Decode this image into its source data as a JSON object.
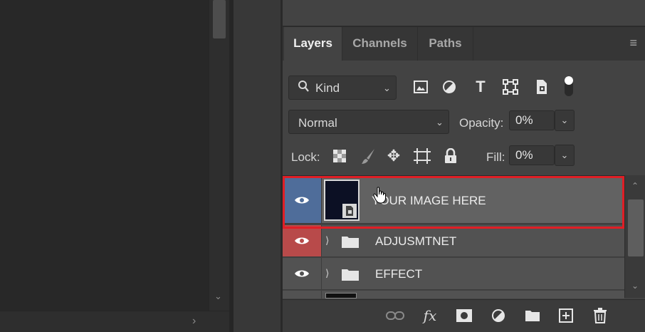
{
  "panel": {
    "tabs": [
      {
        "label": "Layers",
        "active": true
      },
      {
        "label": "Channels",
        "active": false
      },
      {
        "label": "Paths",
        "active": false
      }
    ],
    "menu_icon": "hamburger-icon"
  },
  "filter": {
    "kind_label": "Kind",
    "kind_icon": "search-icon",
    "filter_icons": [
      "image-filter-icon",
      "adjustment-filter-icon",
      "type-filter-icon",
      "shape-filter-icon",
      "smart-object-filter-icon",
      "filter-toggle-icon"
    ]
  },
  "blend": {
    "mode": "Normal",
    "opacity_label": "Opacity:",
    "opacity_value": "0%",
    "fill_label": "Fill:",
    "fill_value": "0%"
  },
  "lock": {
    "label": "Lock:",
    "icons": [
      "lock-transparent-pixels-icon",
      "lock-image-pixels-icon",
      "lock-position-icon",
      "lock-artboard-icon",
      "lock-all-icon"
    ]
  },
  "layers": [
    {
      "name": "YOUR IMAGE HERE",
      "type": "smart-object",
      "visible": true,
      "selected": true,
      "eye_color": "#4f6d9a"
    },
    {
      "name": "ADJUSMTNET",
      "type": "group",
      "visible": true,
      "selected": false,
      "eye_color": "#b84a4a"
    },
    {
      "name": "EFFECT",
      "type": "group",
      "visible": true,
      "selected": false,
      "eye_color": "#525252"
    }
  ],
  "bottom_icons": [
    "link-layers-icon",
    "fx-icon",
    "add-mask-icon",
    "adjustment-layer-icon",
    "new-group-icon",
    "new-layer-icon",
    "delete-icon"
  ],
  "colors": {
    "highlight": "#e01e25",
    "selected_eye": "#4f6d9a",
    "red_eye": "#b84a4a"
  }
}
